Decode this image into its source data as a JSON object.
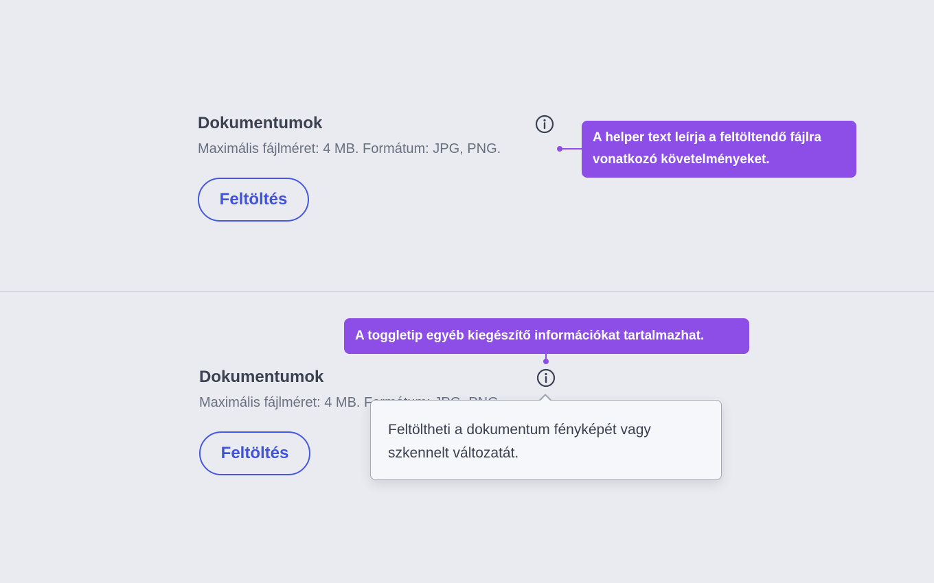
{
  "top_example": {
    "title": "Dokumentumok",
    "helper_text": "Maximális fájlméret: 4 MB. Formátum: JPG, PNG.",
    "info_icon": "info-circle-icon",
    "upload_label": "Feltöltés",
    "annotation_line1": "A helper text leírja a feltöltendő fájlra",
    "annotation_line2": "vonatkozó követelményeket."
  },
  "bottom_example": {
    "title": "Dokumentumok",
    "helper_text": "Maximális fájlméret: 4 MB. Formátum: JPG, PNG.",
    "info_icon": "info-circle-icon",
    "upload_label": "Feltöltés",
    "annotation": "A toggletip egyéb kiegészítő információkat tartalmazhat.",
    "toggletip_line1": "Feltöltheti a dokumentum fényképét vagy",
    "toggletip_line2": "szkennelt változatát."
  },
  "colors": {
    "background": "#e9ebf0",
    "accent_button": "#4153d8",
    "annotation": "#8c4ee6",
    "title_text": "#3b4150",
    "helper_text": "#697080"
  }
}
